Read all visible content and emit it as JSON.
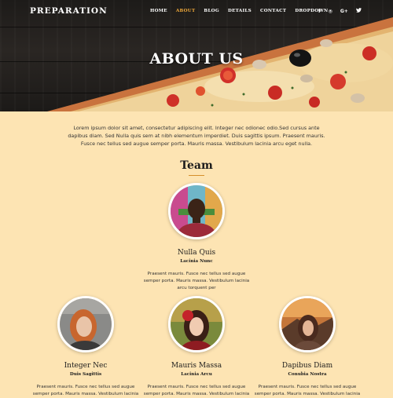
{
  "brand": "PREPARATION",
  "nav": {
    "items": [
      {
        "label": "HOME",
        "active": false
      },
      {
        "label": "ABOUT",
        "active": true
      },
      {
        "label": "BLOG",
        "active": false
      },
      {
        "label": "DETAILS",
        "active": false
      },
      {
        "label": "CONTACT",
        "active": false
      },
      {
        "label": "DROPDOWN",
        "active": false
      }
    ],
    "dropdown_caret": "▾",
    "socials": [
      {
        "icon": "facebook-icon",
        "glyph": "f"
      },
      {
        "icon": "instagram-icon",
        "glyph": "◎"
      },
      {
        "icon": "google-plus-icon",
        "glyph": "G+"
      },
      {
        "icon": "twitter-icon",
        "glyph": "🐦"
      }
    ]
  },
  "hero": {
    "title": "ABOUT US"
  },
  "intro": "Lorem ipsum dolor sit amet, consectetur adipiscing elit. Integer nec odionec odio.Sed cursus ante dapibus diam. Sed Nulla quis sem at nibh elementum imperdiet. Duis sagittis ipsum. Praesent mauris. Fusce nec tellus sed augue semper porta. Mauris massa. Vestibulum lacinia arcu eget nulla.",
  "team": {
    "heading": "Team",
    "members": [
      {
        "name": "Nulla Quis",
        "role": "Lacinia Nunc",
        "desc": "Praesent mauris. Fusce nec tellus sed augue semper porta. Mauris massa. Vestibulum lacinia arcu torquent per"
      },
      {
        "name": "Integer Nec",
        "role": "Duis Sagittis",
        "desc": "Praesent mauris. Fusce nec tellus sed augue semper porta. Mauris massa. Vestibulum lacinia"
      },
      {
        "name": "Mauris Massa",
        "role": "Lacinia Arcu",
        "desc": "Praesent mauris. Fusce nec tellus sed augue semper porta. Mauris massa. Vestibulum lacinia"
      },
      {
        "name": "Dapibus Diam",
        "role": "Conubia Nostra",
        "desc": "Praesent mauris. Fusce nec tellus sed augue semper porta. Mauris massa. Vestibulum lacinia"
      }
    ]
  },
  "colors": {
    "background": "#fde4b3",
    "accent": "#f0a93a",
    "hero_dark": "#1d1b19"
  }
}
